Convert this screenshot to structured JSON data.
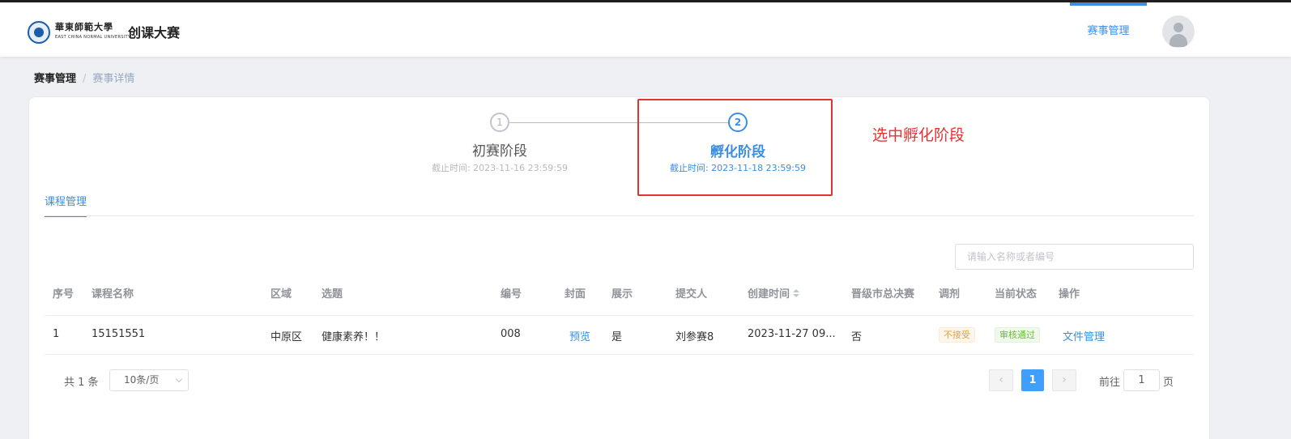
{
  "header": {
    "logo_text": "華東師範大學",
    "logo_subtext": "EAST CHINA NORMAL UNIVERSITY",
    "app_title": "创课大赛",
    "nav_item": "赛事管理",
    "avatar_icon": "user-avatar-icon"
  },
  "breadcrumb": {
    "first": "赛事管理",
    "separator": "/",
    "current": "赛事详情"
  },
  "steps": [
    {
      "number": "1",
      "title": "初赛阶段",
      "deadline": "截止时间: 2023-11-16 23:59:59",
      "active": false
    },
    {
      "number": "2",
      "title": "孵化阶段",
      "deadline": "截止时间: 2023-11-18 23:59:59",
      "active": true
    }
  ],
  "annotation": "选中孵化阶段",
  "tabs": {
    "active": "课程管理"
  },
  "search": {
    "placeholder": "请输入名称或者编号",
    "value": ""
  },
  "table": {
    "headers": [
      "序号",
      "课程名称",
      "区域",
      "选题",
      "编号",
      "封面",
      "展示",
      "提交人",
      "创建时间",
      "晋级市总决赛",
      "调剂",
      "当前状态",
      "操作"
    ],
    "rows": [
      {
        "index": "1",
        "course_name": "15151551",
        "region": "中原区",
        "topic": "健康素养！！",
        "code": "008",
        "cover": "预览",
        "display": "是",
        "submitter": "刘参赛8",
        "created": "2023-11-27 09...",
        "promoted": "否",
        "transfer": "不接受",
        "status": "审核通过",
        "action": "文件管理"
      }
    ]
  },
  "pagination": {
    "total": "共 1 条",
    "page_size": "10条/页",
    "prev": "‹",
    "current": "1",
    "next": "›",
    "goto_label": "前往",
    "goto_value": "1",
    "goto_suffix": "页"
  },
  "colors": {
    "accent": "#3a8ee6",
    "annotation_red": "#e43232",
    "pagination_active": "#409eff"
  }
}
